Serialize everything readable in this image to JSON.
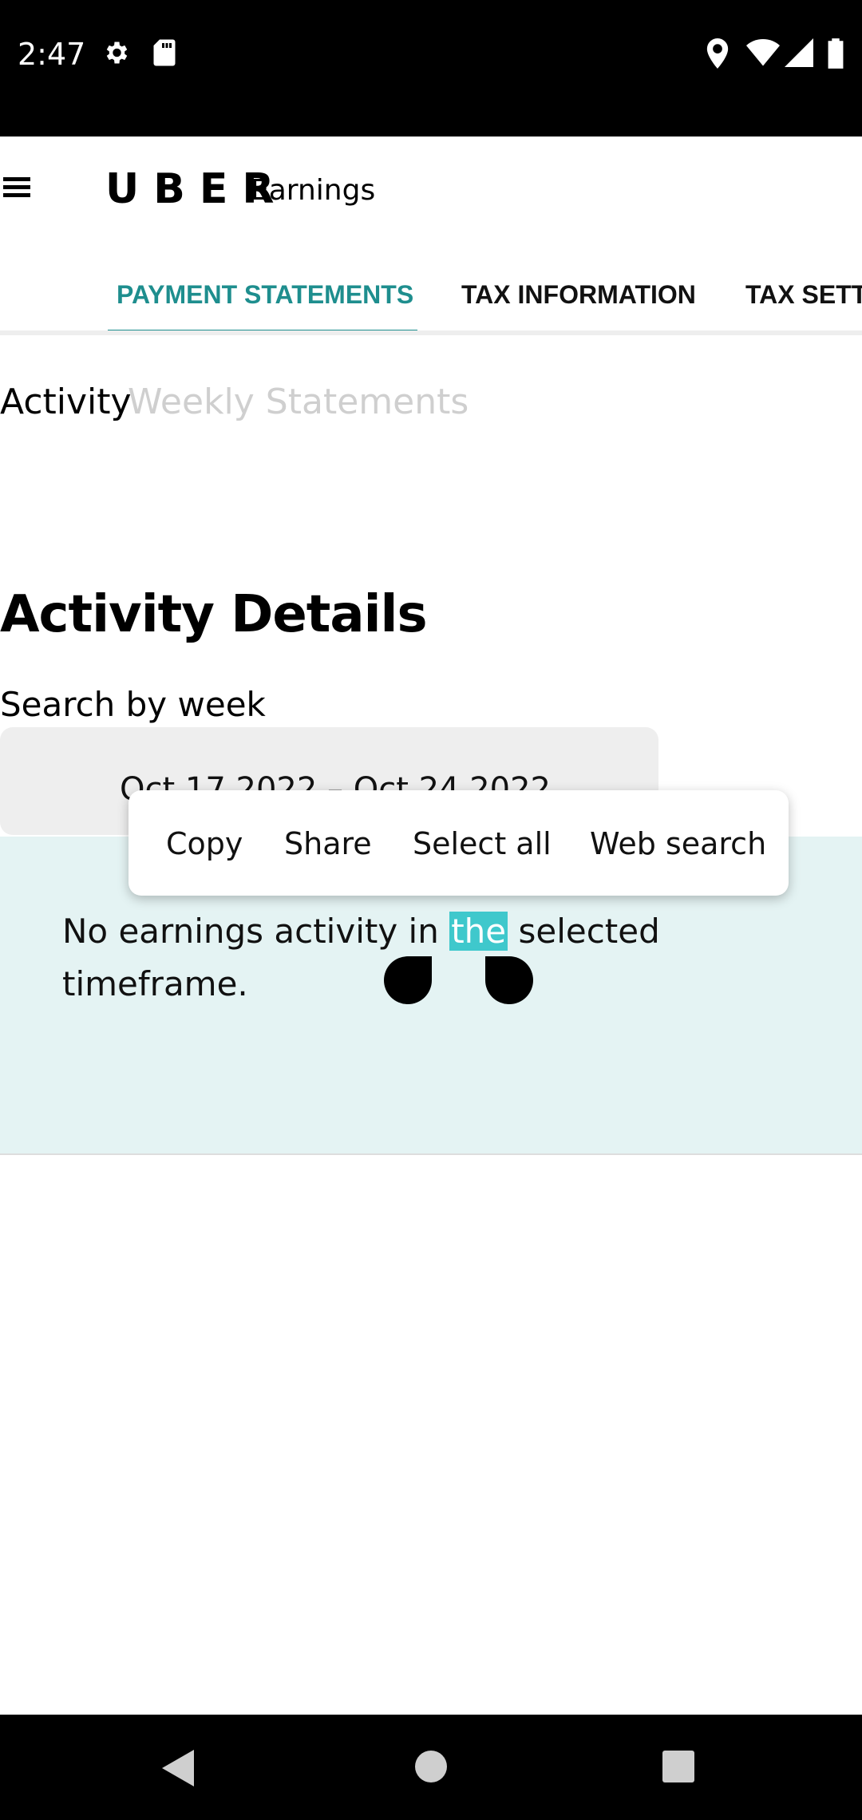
{
  "status_bar": {
    "time": "2:47",
    "icons": [
      "gear-icon",
      "sd-card-icon",
      "location-icon",
      "wifi-icon",
      "signal-icon",
      "battery-icon"
    ]
  },
  "header": {
    "brand": "UBER",
    "subtitle": "Earnings"
  },
  "tabs": [
    {
      "label": "PAYMENT STATEMENTS",
      "active": true
    },
    {
      "label": "TAX INFORMATION",
      "active": false
    },
    {
      "label": "TAX SETT",
      "active": false
    }
  ],
  "subtabs": [
    {
      "label": "Activity",
      "active": true
    },
    {
      "label": "Weekly Statements",
      "active": false
    }
  ],
  "main": {
    "title": "Activity Details",
    "search_label": "Search by week",
    "week_range": "Oct 17 2022 – Oct 24 2022",
    "empty_message": {
      "before": "No earnings activity in ",
      "selected": "the",
      "after": " selected timeframe."
    }
  },
  "context_menu": {
    "items": [
      "Copy",
      "Share",
      "Select all",
      "Web search"
    ]
  },
  "colors": {
    "accent": "#1e8e8e",
    "selection": "#3fc8cc",
    "panel": "#e4f3f3"
  }
}
